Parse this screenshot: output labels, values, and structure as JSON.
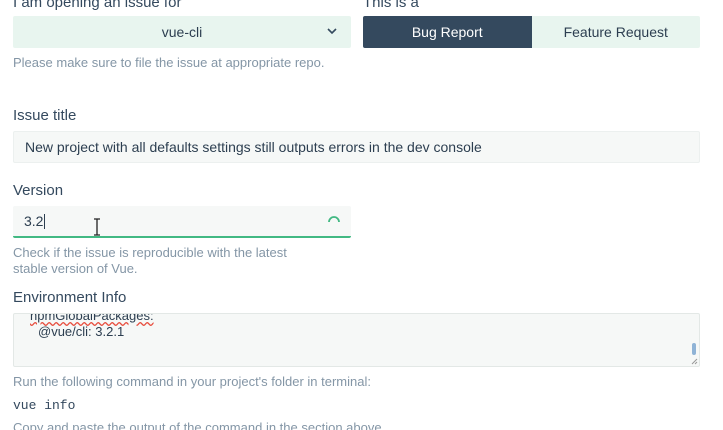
{
  "repo": {
    "label": "I am opening an issue for",
    "selected": "vue-cli",
    "hint": "Please make sure to file the issue at appropriate repo."
  },
  "issue_type": {
    "label": "This is a",
    "options": [
      "Bug Report",
      "Feature Request"
    ],
    "selected": "Bug Report"
  },
  "issue_title": {
    "label": "Issue title",
    "value": "New project with all defaults settings still outputs errors in the dev console"
  },
  "version": {
    "label": "Version",
    "value": "3.2",
    "hint_line1": "Check if the issue is reproducible with the latest",
    "hint_line2": "stable version of Vue."
  },
  "environment": {
    "label": "Environment Info",
    "line1": "npmGlobalPackages:",
    "line2": "@vue/cli: 3.2.1",
    "hint_run": "Run the following command in your project's folder in terminal:",
    "command": "vue info",
    "hint_copy": "Copy and paste the output of the command in the section above."
  },
  "colors": {
    "accent": "#42b983",
    "dark": "#34495e",
    "field_bg": "#e8f5ef"
  }
}
